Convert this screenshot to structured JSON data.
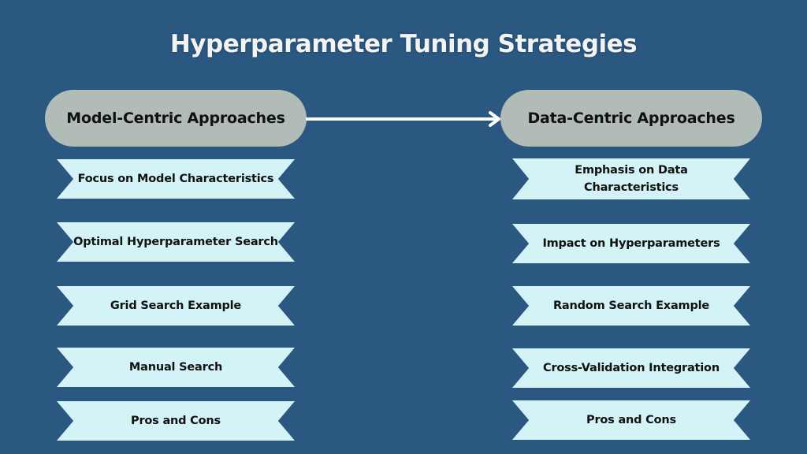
{
  "title": "Hyperparameter Tuning Strategies",
  "colors": {
    "background": "#2a5880",
    "header_pill": "#b1bcb7",
    "ribbon": "#d3f3f7",
    "title_text": "#f3f3f3",
    "arrow": "#ffffff"
  },
  "left": {
    "header": "Model-Centric Approaches",
    "items": [
      "Focus on Model Characteristics",
      "Optimal Hyperparameter Search",
      "Grid Search Example",
      "Manual Search",
      "Pros and Cons"
    ]
  },
  "right": {
    "header": "Data-Centric Approaches",
    "items": [
      "Emphasis on Data Characteristics",
      "Impact on Hyperparameters",
      "Random Search Example",
      "Cross-Validation Integration",
      "Pros and Cons"
    ]
  },
  "connector": {
    "from": "Model-Centric Approaches",
    "to": "Data-Centric Approaches",
    "icon": "arrow-right-icon"
  }
}
